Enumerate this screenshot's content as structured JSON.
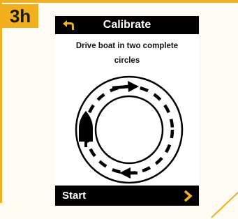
{
  "step": {
    "label": "3h"
  },
  "screen": {
    "title": "Calibrate",
    "instructions_line1": "Drive boat in two complete",
    "instructions_line2": "circles",
    "start_label": "Start"
  },
  "icons": {
    "back": "back-arrow-icon",
    "boat": "boat-icon",
    "forward": "chevron-right-icon"
  },
  "colors": {
    "accent": "#f2b01e",
    "screen_bar": "#000000",
    "background": "#fdfbf2"
  }
}
